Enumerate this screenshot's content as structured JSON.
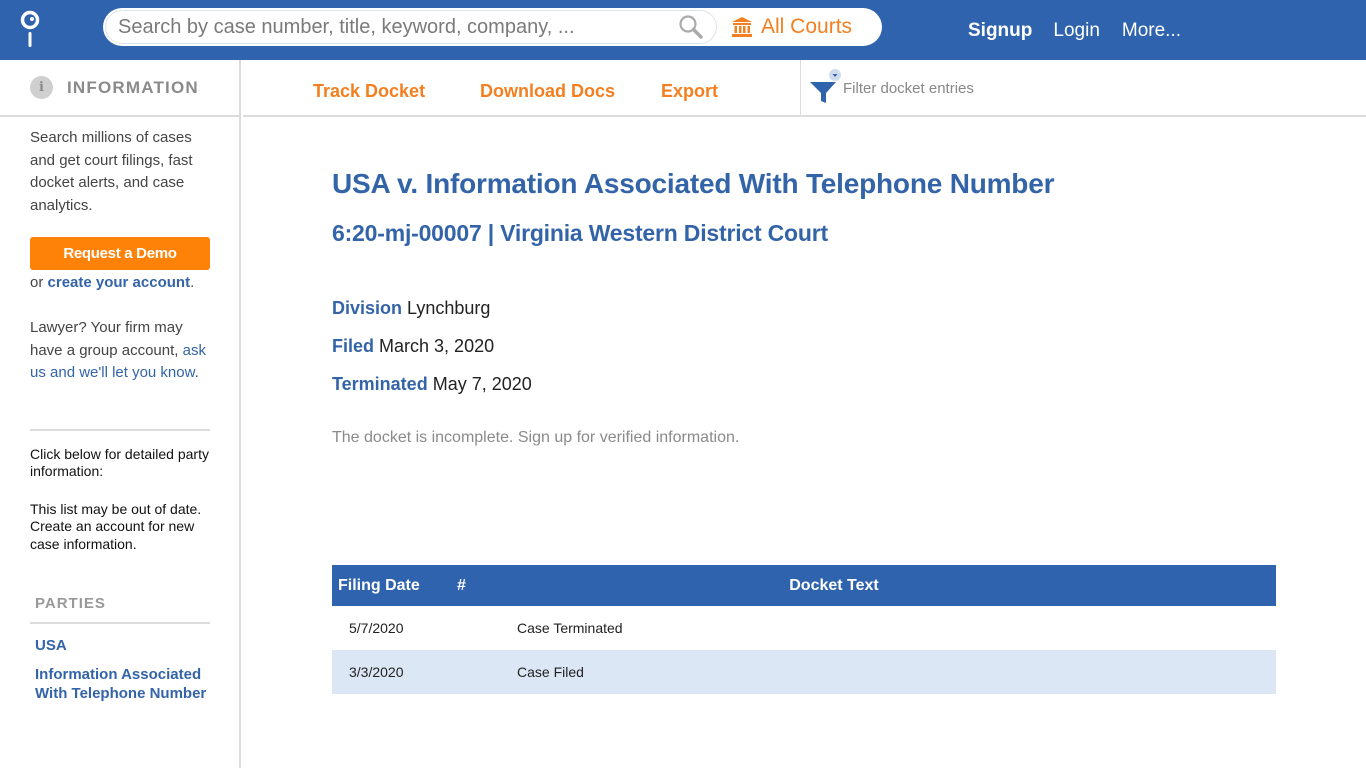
{
  "header": {
    "logo": "casetext-logo-icon",
    "search": {
      "placeholder": "Search by case number, title, keyword, company, ...",
      "value": ""
    },
    "courts_label": "All Courts",
    "nav": {
      "signup": "Signup",
      "login": "Login",
      "more": "More..."
    }
  },
  "toolbar": {
    "track": "Track Docket",
    "download": "Download Docs",
    "export": "Export",
    "filter_placeholder": "Filter docket entries"
  },
  "sidebar": {
    "title": "INFORMATION",
    "info_icon_glyph": "i",
    "intro": "Search millions of cases and get court filings, fast docket alerts, and case analytics.",
    "demo_button": "Request a Demo",
    "or_text": "or ",
    "create_account": "create your account",
    "period": ".",
    "lawyer_text": "Lawyer? Your firm may have a group account, ",
    "lawyer_link": "ask us and we'll let you know",
    "party_note_1": "Click below for detailed party information:",
    "party_note_2": "This list may be out of date. Create an account for new case information.",
    "parties_title": "PARTIES",
    "parties": [
      "USA",
      "Information Associated With Telephone Number"
    ]
  },
  "case": {
    "title": "USA v. Information Associated With Telephone Number",
    "subtitle": "6:20-mj-00007 | Virginia Western District Court",
    "meta": [
      {
        "label": "Division",
        "value": "Lynchburg"
      },
      {
        "label": "Filed",
        "value": "March 3, 2020"
      },
      {
        "label": "Terminated",
        "value": "May 7, 2020"
      }
    ],
    "notice": "The docket is incomplete. Sign up for verified information."
  },
  "docket": {
    "columns": [
      "Filing Date",
      "#",
      "Docket Text"
    ],
    "rows": [
      {
        "date": "5/7/2020",
        "num": "",
        "text": "Case Terminated"
      },
      {
        "date": "3/3/2020",
        "num": "",
        "text": "Case Filed"
      }
    ]
  },
  "colors": {
    "brand_blue": "#2f63ad",
    "accent_orange": "#f47f20",
    "button_orange": "#ff8208",
    "row_alt": "#dbe7f5"
  }
}
